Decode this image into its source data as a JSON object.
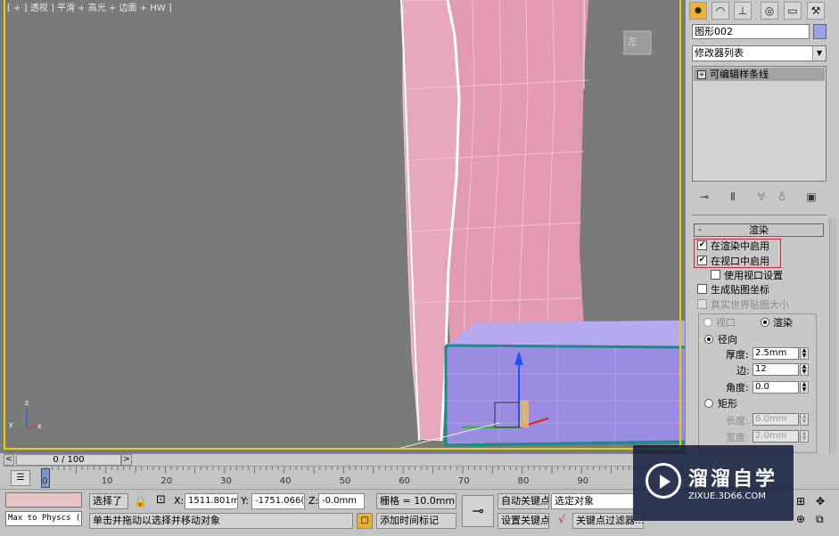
{
  "viewport": {
    "label": "[ + ] 透视 ] 平滑 + 高光 + 边面 + HW ]",
    "viewcube_label": "左",
    "colors": {
      "background": "#7a7a7a",
      "border": "#e8d000",
      "pink": "#e8a8bc",
      "purple": "#9a8ce0",
      "selection": "#1a8a8a"
    }
  },
  "command_panel": {
    "tabs": [
      "create-icon",
      "modify-icon",
      "hierarchy-icon",
      "motion-icon",
      "display-icon",
      "utilities-icon"
    ],
    "object_name": "图形002",
    "object_color": "#9aa3e6",
    "modifier_list_label": "修改器列表",
    "modifier_stack": [
      "可编辑样条线"
    ],
    "rendering": {
      "title": "渲染",
      "enable_in_renderer": "在渲染中启用",
      "enable_in_viewport": "在视口中启用",
      "use_viewport_settings": "使用视口设置",
      "generate_mapping": "生成贴图坐标",
      "real_world_map_size": "真实世界贴图大小",
      "viewport_radio": "视口",
      "render_radio": "渲染",
      "radial": "径向",
      "thickness_label": "厚度:",
      "thickness_value": "2.5mm",
      "sides_label": "边:",
      "sides_value": "12",
      "angle_label": "角度:",
      "angle_value": "0.0",
      "rectangular": "矩形",
      "length_label": "长度:",
      "length_value": "6.0mm",
      "width_label": "宽度:",
      "width_value": "2.0mm"
    }
  },
  "timeline": {
    "frame_display": "0 / 100",
    "ticks": [
      "0",
      "10",
      "20",
      "30",
      "40",
      "50",
      "60",
      "70",
      "80",
      "90"
    ]
  },
  "status": {
    "maxscript": "Max to Physcs (",
    "selected": "选择了",
    "x_label": "X:",
    "x_value": "1511.801m",
    "y_label": "Y:",
    "y_value": "-1751.066(",
    "z_label": "Z:",
    "z_value": "-0.0mm",
    "grid": "栅格 = 10.0mm",
    "auto_key": "自动关键点",
    "selected_object": "选定对象",
    "set_key": "设置关键点",
    "key_filters": "关键点过滤器...",
    "hint": "单击并拖动以选择并移动对象",
    "add_time_tag": "添加时间标记"
  },
  "watermark": {
    "title": "溜溜自学",
    "url": "ZIXUE.3D66.COM"
  }
}
